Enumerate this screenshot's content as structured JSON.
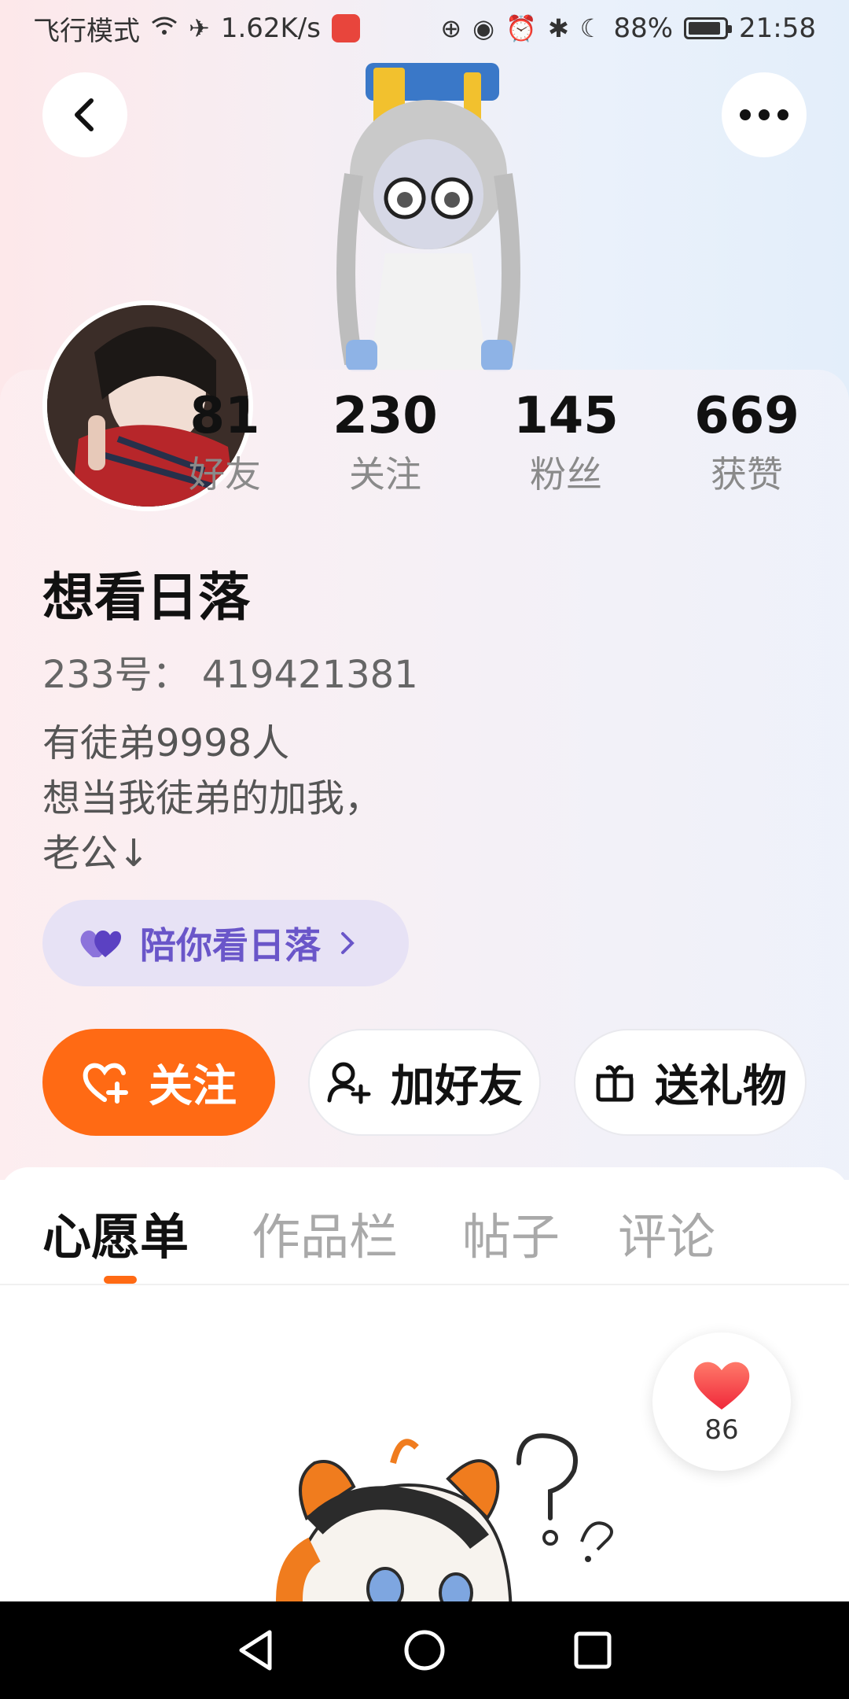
{
  "status_bar": {
    "airplane_text": "飞行模式",
    "net_speed": "1.62K/s",
    "battery": "88%",
    "time": "21:58"
  },
  "stats": [
    {
      "value": "81",
      "label": "好友"
    },
    {
      "value": "230",
      "label": "关注"
    },
    {
      "value": "145",
      "label": "粉丝"
    },
    {
      "value": "669",
      "label": "获赞"
    }
  ],
  "profile": {
    "name": "想看日落",
    "id_line": "233号： 419421381",
    "bio": [
      "有徒弟9998人",
      "想当我徒弟的加我，",
      "老公↓"
    ],
    "tag": "陪你看日落"
  },
  "actions": {
    "follow": "关注",
    "add_friend": "加好友",
    "gift": "送礼物"
  },
  "tabs": [
    "心愿单",
    "作品栏",
    "帖子",
    "评论"
  ],
  "like_count": "86",
  "colors": {
    "accent": "#ff6a14",
    "tag_text": "#6a56c9"
  }
}
